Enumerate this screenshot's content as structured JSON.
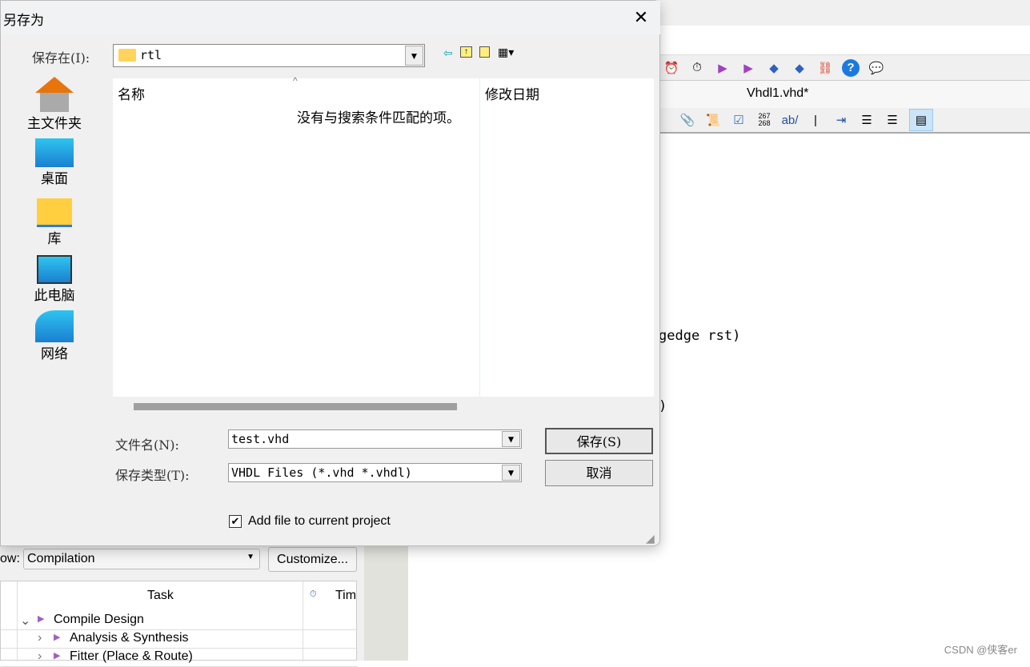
{
  "background_app": {
    "tab_title": "Vhdl1.vhd*",
    "toolbar2_numbers": "267\n268",
    "toolbar2_ab": "ab/",
    "code_lines": [
      "gedge rst)",
      ")"
    ],
    "flow": {
      "label": "ow:",
      "selected": "Compilation",
      "customize_label": "Customize...",
      "columns": [
        "Task",
        "Tim"
      ],
      "rows": [
        {
          "label": "Compile Design",
          "expanded": true
        },
        {
          "label": "Analysis & Synthesis",
          "expanded": false
        },
        {
          "label": "Fitter (Place & Route)",
          "expanded": false
        }
      ]
    }
  },
  "dialog": {
    "title": "另存为",
    "save_in_label": "保存在(I):",
    "location": "rtl",
    "places": [
      "主文件夹",
      "桌面",
      "库",
      "此电脑",
      "网络"
    ],
    "columns": [
      "名称",
      "修改日期"
    ],
    "empty_message": "没有与搜索条件匹配的项。",
    "filename_label": "文件名(N):",
    "filename": "test.vhd",
    "filetype_label": "保存类型(T):",
    "filetype": "VHDL Files (*.vhd *.vhdl)",
    "save_label": "保存(S)",
    "cancel_label": "取消",
    "add_to_project_label": "Add file to current project",
    "add_to_project_checked": true
  },
  "watermark": "CSDN @侠客er"
}
